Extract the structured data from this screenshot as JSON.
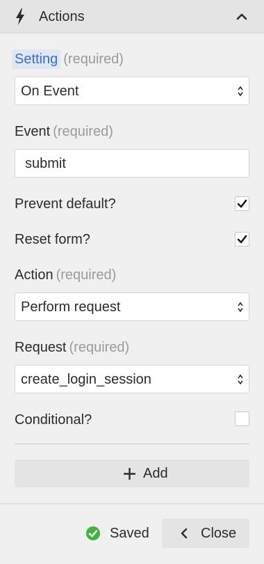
{
  "header": {
    "title": "Actions"
  },
  "setting": {
    "label": "Setting",
    "required": "(required)",
    "value": "On Event"
  },
  "event": {
    "label": "Event",
    "required": "(required)",
    "value": "submit"
  },
  "prevent_default": {
    "label": "Prevent default?",
    "checked": true
  },
  "reset_form": {
    "label": "Reset form?",
    "checked": true
  },
  "action": {
    "label": "Action",
    "required": "(required)",
    "value": "Perform request"
  },
  "request": {
    "label": "Request",
    "required": "(required)",
    "value": "create_login_session"
  },
  "conditional": {
    "label": "Conditional?",
    "checked": false
  },
  "add_button": {
    "label": "Add"
  },
  "footer": {
    "saved_label": "Saved",
    "close_label": "Close"
  },
  "colors": {
    "accent": "#3a6fc7",
    "success": "#3fb43f",
    "panel": "#f0f0f0",
    "header": "#e4e4e4"
  }
}
